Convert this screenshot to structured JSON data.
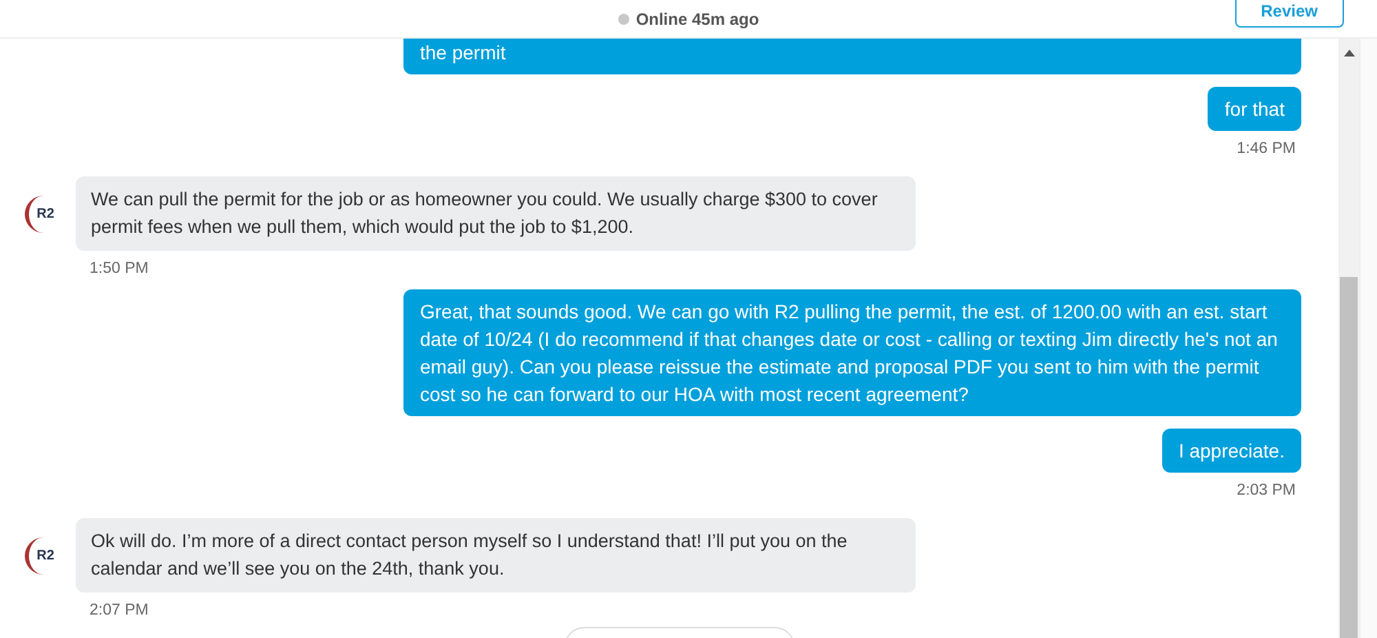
{
  "header": {
    "status": "Online 45m ago",
    "online": false,
    "review_button": "Review"
  },
  "messages": [
    {
      "kind": "outgoing",
      "text": "the permit"
    },
    {
      "kind": "outgoing",
      "text": "for that",
      "time": "1:46 PM"
    },
    {
      "kind": "incoming",
      "avatar": "R2",
      "text": "We can pull the permit for the job or as homeowner you could. We usually charge $300 to cover permit fees when we pull them, which would put the job to $1,200.",
      "time": "1:50 PM"
    },
    {
      "kind": "outgoing",
      "text": "Great, that sounds good. We can go with R2 pulling the permit, the est. of 1200.00 with an est. start date of 10/24 (I do recommend if that changes date or cost - calling or texting Jim directly he's not an email guy). Can you please reissue the estimate and proposal PDF you sent to him with the permit cost so he can forward to our HOA with most recent agreement?"
    },
    {
      "kind": "outgoing",
      "text": "I appreciate.",
      "time": "2:03 PM"
    },
    {
      "kind": "incoming",
      "avatar": "R2",
      "text": "Ok will do. I’m more of a direct contact person myself so I understand that! I’ll put you on the calendar and we’ll see you on the 24th, thank you.",
      "time": "2:07 PM"
    }
  ]
}
